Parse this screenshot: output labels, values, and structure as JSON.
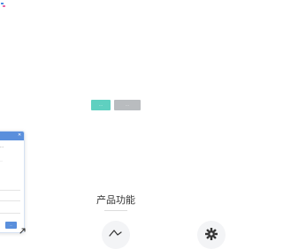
{
  "hero": {
    "primary_button_label": "…",
    "secondary_button_label": "…"
  },
  "section": {
    "title": "产品功能"
  },
  "chat": {
    "message": "…",
    "subtext": "…",
    "send_label": "…"
  },
  "icons": {
    "logo": "brand-logo",
    "feature_1": "line-trend-icon",
    "feature_2": "gear-icon",
    "chat_close": "close-icon",
    "corner": "pointer-icon"
  },
  "colors": {
    "primary_button": "#5fd0c0",
    "secondary_button": "#b9bcbf",
    "chat_header": "#5a8fdc",
    "title_text": "#333333"
  }
}
